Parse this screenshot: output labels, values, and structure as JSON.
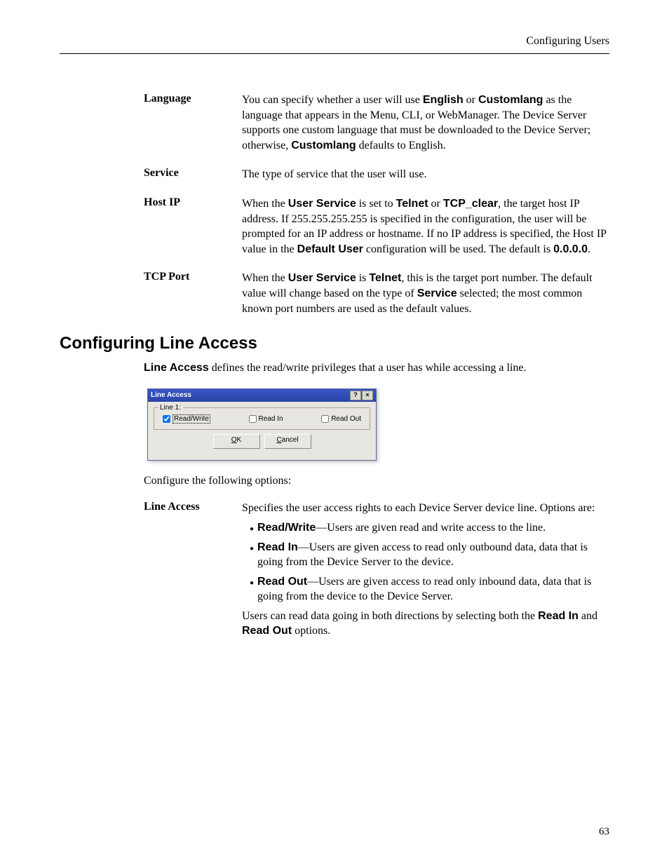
{
  "header": {
    "title": "Configuring Users"
  },
  "defs": [
    {
      "label": "Language",
      "parts": [
        "You can specify whether a user will use ",
        {
          "b": "English"
        },
        " or ",
        {
          "b": "Customlang"
        },
        " as the language that appears in the Menu, CLI, or WebManager. The Device Server supports one custom language that must be downloaded to the Device Server; otherwise, ",
        {
          "b": "Customlang"
        },
        " defaults to English."
      ]
    },
    {
      "label": "Service",
      "parts": [
        "The type of service that the user will use."
      ]
    },
    {
      "label": "Host IP",
      "parts": [
        "When the ",
        {
          "b": "User Service"
        },
        " is set to ",
        {
          "b": "Telnet"
        },
        " or ",
        {
          "b": "TCP_clear"
        },
        ", the target host IP address. If 255.255.255.255 is specified in the configuration, the user will be prompted for an IP address or hostname. If no IP address is specified, the Host IP value in the ",
        {
          "b": "Default User"
        },
        " configuration will be used. The default is ",
        {
          "b": "0.0.0.0"
        },
        "."
      ]
    },
    {
      "label": "TCP Port",
      "parts": [
        "When the ",
        {
          "b": "User Service"
        },
        " is ",
        {
          "b": "Telnet"
        },
        ", this is the target port number. The default value will change based on the type of ",
        {
          "b": "Service"
        },
        " selected; the most common known port numbers are used as the default values."
      ]
    }
  ],
  "section_heading": "Configuring Line Access",
  "intro_parts": [
    {
      "b": "Line Access"
    },
    " defines the read/write privileges that a user has while accessing a line."
  ],
  "dialog": {
    "title": "Line Access",
    "help": "?",
    "close": "×",
    "fieldset_legend": "Line 1:",
    "checkboxes": {
      "read_write": {
        "label": "Read/Write",
        "checked": true,
        "focused": true
      },
      "read_in": {
        "label": "Read In",
        "checked": false
      },
      "read_out": {
        "label": "Read Out",
        "checked": false
      }
    },
    "ok_label": "OK",
    "cancel_label": "Cancel"
  },
  "configure_line": "Configure the following options:",
  "line_access_label": "Line Access",
  "line_access_intro": "Specifies the user access rights to each Device Server device line. Options are:",
  "bullets": [
    [
      {
        "b": "Read/Write"
      },
      "—Users are given read and write access to the line."
    ],
    [
      {
        "b": "Read In"
      },
      "—Users are given access to read only outbound data, data that is going from the Device Server to the device."
    ],
    [
      {
        "b": "Read Out"
      },
      "—Users are given access to read only inbound data, data that is going from the device to the Device Server."
    ]
  ],
  "line_access_tail_parts": [
    "Users can read data going in both directions by selecting both the ",
    {
      "b": "Read In"
    },
    " and ",
    {
      "b": "Read Out"
    },
    " options."
  ],
  "page_number": "63"
}
